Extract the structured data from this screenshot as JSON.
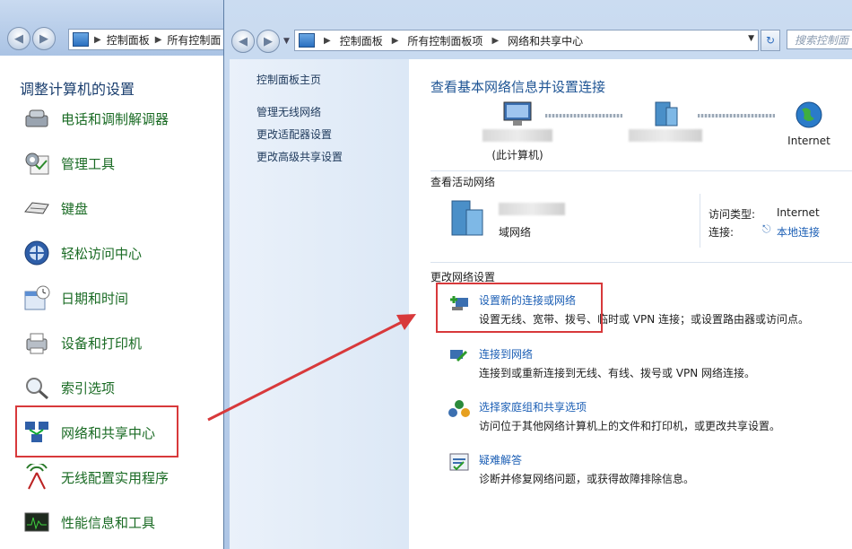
{
  "back_window": {
    "breadcrumb": [
      "控制面板",
      "所有控制面"
    ],
    "title": "调整计算机的设置",
    "items": [
      {
        "label": "电话和调制解调器",
        "icon": "phone-modem-icon"
      },
      {
        "label": "管理工具",
        "icon": "admin-tools-icon"
      },
      {
        "label": "键盘",
        "icon": "keyboard-icon"
      },
      {
        "label": "轻松访问中心",
        "icon": "ease-of-access-icon"
      },
      {
        "label": "日期和时间",
        "icon": "date-time-icon"
      },
      {
        "label": "设备和打印机",
        "icon": "devices-printers-icon"
      },
      {
        "label": "索引选项",
        "icon": "indexing-options-icon"
      },
      {
        "label": "网络和共享中心",
        "icon": "network-sharing-icon"
      },
      {
        "label": "无线配置实用程序",
        "icon": "wireless-utility-icon"
      },
      {
        "label": "性能信息和工具",
        "icon": "performance-icon"
      }
    ]
  },
  "front_window": {
    "breadcrumb": [
      "控制面板",
      "所有控制面板项",
      "网络和共享中心"
    ],
    "search_placeholder": "搜索控制面",
    "left_links": [
      "控制面板主页",
      "管理无线网络",
      "更改适配器设置",
      "更改高级共享设置"
    ],
    "heading": "查看基本网络信息并设置连接",
    "map": {
      "this_computer": "(此计算机)",
      "internet": "Internet"
    },
    "active_networks": {
      "header": "查看活动网络",
      "network_type": "域网络",
      "access_type_label": "访问类型:",
      "access_type_value": "Internet",
      "connection_label": "连接:",
      "connection_value": "本地连接"
    },
    "change_settings": {
      "header": "更改网络设置",
      "tasks": [
        {
          "title": "设置新的连接或网络",
          "desc": "设置无线、宽带、拨号、临时或 VPN 连接；或设置路由器或访问点。",
          "icon": "new-connection-icon"
        },
        {
          "title": "连接到网络",
          "desc": "连接到或重新连接到无线、有线、拨号或 VPN 网络连接。",
          "icon": "connect-network-icon"
        },
        {
          "title": "选择家庭组和共享选项",
          "desc": "访问位于其他网络计算机上的文件和打印机，或更改共享设置。",
          "icon": "homegroup-icon"
        },
        {
          "title": "疑难解答",
          "desc": "诊断并修复网络问题，或获得故障排除信息。",
          "icon": "troubleshoot-icon"
        }
      ]
    }
  },
  "colors": {
    "highlight": "#d8393b",
    "link": "#1c5fb5",
    "item_green": "#1a6b24"
  }
}
